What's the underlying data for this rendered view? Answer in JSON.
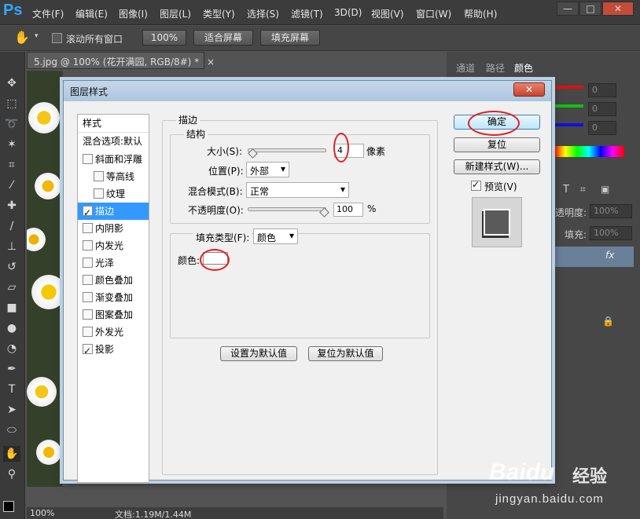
{
  "app": {
    "logo": "Ps"
  },
  "menu": [
    "文件(F)",
    "编辑(E)",
    "图像(I)",
    "图层(L)",
    "类型(Y)",
    "选择(S)",
    "滤镜(T)",
    "3D(D)",
    "视图(V)",
    "窗口(W)",
    "帮助(H)"
  ],
  "window_controls": {
    "minimize": "—",
    "maximize": "□",
    "close": "✕"
  },
  "options_bar": {
    "scroll_all_label": "滚动所有窗口",
    "zoom_100": "100%",
    "fit_screen": "适合屏幕",
    "fill_screen": "填充屏幕"
  },
  "document": {
    "tab_title": "5.jpg @ 100% (花开满园, RGB/8#) *",
    "tab_close": "×",
    "zoom": "100%",
    "doc_size": "文档:1.19M/1.44M"
  },
  "right_panel": {
    "tabs": [
      "通道",
      "路径",
      "颜色"
    ],
    "rgb_values": [
      "0",
      "0",
      "0"
    ],
    "opacity_label": "透明度:",
    "opacity_value": "100%",
    "fill_label": "填充:",
    "fill_value": "100%",
    "fx": "fx"
  },
  "dialog": {
    "title": "图层样式",
    "close": "✕",
    "styles_header": "样式",
    "blend_options": "混合选项:默认",
    "styles": [
      {
        "label": "斜面和浮雕",
        "checked": false,
        "indent": false,
        "active": false
      },
      {
        "label": "等高线",
        "checked": false,
        "indent": true,
        "active": false
      },
      {
        "label": "纹理",
        "checked": false,
        "indent": true,
        "active": false
      },
      {
        "label": "描边",
        "checked": true,
        "indent": false,
        "active": true
      },
      {
        "label": "内阴影",
        "checked": false,
        "indent": false,
        "active": false
      },
      {
        "label": "内发光",
        "checked": false,
        "indent": false,
        "active": false
      },
      {
        "label": "光泽",
        "checked": false,
        "indent": false,
        "active": false
      },
      {
        "label": "颜色叠加",
        "checked": false,
        "indent": false,
        "active": false
      },
      {
        "label": "渐变叠加",
        "checked": false,
        "indent": false,
        "active": false
      },
      {
        "label": "图案叠加",
        "checked": false,
        "indent": false,
        "active": false
      },
      {
        "label": "外发光",
        "checked": false,
        "indent": false,
        "active": false
      },
      {
        "label": "投影",
        "checked": true,
        "indent": false,
        "active": false
      }
    ],
    "stroke": {
      "section": "描边",
      "structure": "结构",
      "size_label": "大小(S):",
      "size_value": "4",
      "size_unit": "像素",
      "position_label": "位置(P):",
      "position_value": "外部",
      "blend_label": "混合模式(B):",
      "blend_value": "正常",
      "opacity_label": "不透明度(O):",
      "opacity_value": "100",
      "opacity_unit": "%",
      "fill_type_label": "填充类型(F):",
      "fill_type_value": "颜色",
      "color_label": "颜色:",
      "color_swatch": "#ffffff"
    },
    "set_default": "设置为默认值",
    "reset_default": "复位为默认值",
    "ok": "确定",
    "reset": "复位",
    "new_style": "新建样式(W)...",
    "preview_label": "预览(V)",
    "preview_checked": true
  },
  "watermark": {
    "brand": "Baidu",
    "brand_cn": "经验",
    "url": "jingyan.baidu.com"
  }
}
